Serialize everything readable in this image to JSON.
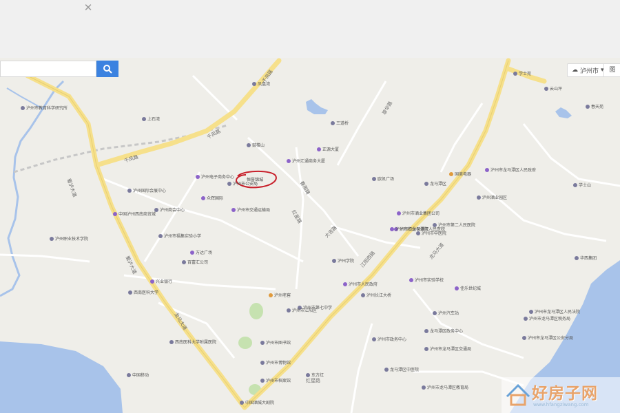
{
  "search": {
    "placeholder": "",
    "clear_icon": "close-icon",
    "button_icon": "search-icon"
  },
  "controls": {
    "city": "泸州市",
    "city_icon": "cloud-icon",
    "layer_label": "图"
  },
  "colors": {
    "accent": "#3b82e0",
    "water": "#a8c3ea",
    "road_yellow": "#f6e08b",
    "marker": "#c8202b"
  },
  "roads": [
    "千凤路",
    "千凤路",
    "千凤路",
    "蜀泸大道",
    "蜀泸大道",
    "龙马大道",
    "春雨路",
    "红星路",
    "江阳西路",
    "大吉路",
    "龙马大道",
    "翠华路",
    "红星路"
  ],
  "marked": {
    "label": "恒誉锦城",
    "marker": "circle"
  },
  "pois": [
    {
      "t": "泸州市教育科学研究所",
      "c": ""
    },
    {
      "t": "上石湾",
      "c": ""
    },
    {
      "t": "凤凰湾",
      "c": ""
    },
    {
      "t": "三道桥",
      "c": ""
    },
    {
      "t": "学士苑",
      "c": ""
    },
    {
      "t": "云山坪",
      "c": ""
    },
    {
      "t": "春天苑",
      "c": ""
    },
    {
      "t": "泸州国际会展中心",
      "c": ""
    },
    {
      "t": "学士山",
      "c": ""
    },
    {
      "t": "鼓楼山",
      "c": ""
    },
    {
      "t": "泸州电子商务中心",
      "c": "purple"
    },
    {
      "t": "众辉国际",
      "c": "purple"
    },
    {
      "t": "泸州市公安局",
      "c": ""
    },
    {
      "t": "正源大厦",
      "c": "purple"
    },
    {
      "t": "泸州商会中心",
      "c": ""
    },
    {
      "t": "泸州市交通运输局",
      "c": "purple"
    },
    {
      "t": "中国泸州西南商贸城",
      "c": "purple"
    },
    {
      "t": "泸州汇通商务大厦",
      "c": "purple"
    },
    {
      "t": "泸州市酒业集团公司",
      "c": "purple"
    },
    {
      "t": "泸州职业技术学院",
      "c": ""
    },
    {
      "t": "泸州市福集实验小学",
      "c": ""
    },
    {
      "t": "万达广场",
      "c": "purple"
    },
    {
      "t": "百富汇公司",
      "c": ""
    },
    {
      "t": "泸州酒业园区",
      "c": ""
    },
    {
      "t": "兴业银行",
      "c": "purple"
    },
    {
      "t": "西南医科大学",
      "c": ""
    },
    {
      "t": "泸州老窖",
      "c": "orange"
    },
    {
      "t": "泸州市第七中学",
      "c": ""
    },
    {
      "t": "泸州市人民政府",
      "c": "purple"
    },
    {
      "t": "欧凯广场",
      "c": ""
    },
    {
      "t": "泸州市龙马潭区人民医院",
      "c": "purple"
    },
    {
      "t": "龙马潭区",
      "c": ""
    },
    {
      "t": "泸州市中医院",
      "c": ""
    },
    {
      "t": "泸州学院",
      "c": ""
    },
    {
      "t": "泸州市龙马潭区人民政府",
      "c": "purple"
    },
    {
      "t": "西南医科大学附属医院",
      "c": ""
    },
    {
      "t": "泸州市妇幼保健院",
      "c": "purple"
    },
    {
      "t": "泸州市第二人民医院",
      "c": ""
    },
    {
      "t": "佳乐世纪城",
      "c": "purple"
    },
    {
      "t": "泸州市政务中心",
      "c": ""
    },
    {
      "t": "泸州长江大桥",
      "c": ""
    },
    {
      "t": "泸州汽车站",
      "c": ""
    },
    {
      "t": "泸州市图书馆",
      "c": ""
    },
    {
      "t": "泸州市档案馆",
      "c": ""
    },
    {
      "t": "泸州市博物馆",
      "c": ""
    },
    {
      "t": "泸州市江阳区",
      "c": ""
    },
    {
      "t": "中国酒城大剧院",
      "c": ""
    },
    {
      "t": "东方红",
      "c": ""
    },
    {
      "t": "泸州市实验学校",
      "c": "purple"
    },
    {
      "t": "龙马潭区中医院",
      "c": ""
    },
    {
      "t": "泸州市龙马潭区教育局",
      "c": ""
    },
    {
      "t": "龙马潭区政务中心",
      "c": ""
    },
    {
      "t": "泸州市龙马潭区交通局",
      "c": ""
    },
    {
      "t": "泸州市龙马潭区公安分局",
      "c": ""
    },
    {
      "t": "泸州市龙马潭区税务局",
      "c": ""
    },
    {
      "t": "中国移动",
      "c": ""
    },
    {
      "t": "国美电器",
      "c": "orange"
    },
    {
      "t": "泸州市龙马潭区人民法院",
      "c": ""
    },
    {
      "t": "华西集团",
      "c": ""
    }
  ],
  "watermark": {
    "title": "好房子网",
    "url": "www.hfangziwang.com",
    "logo_icon": "house-logo-icon"
  }
}
